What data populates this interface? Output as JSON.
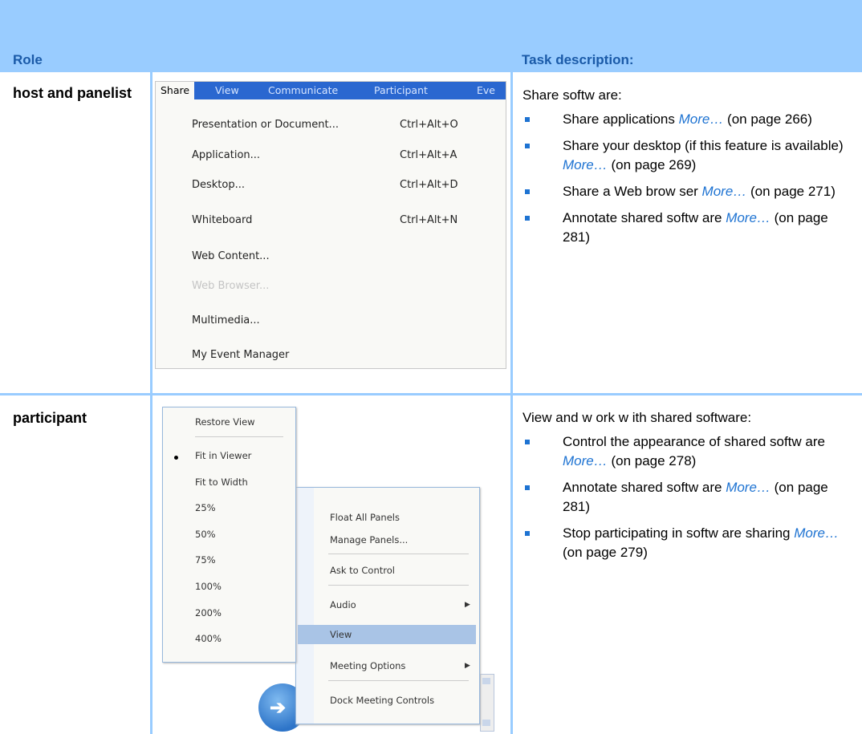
{
  "header": {
    "role_label": "Role",
    "task_label": "Task description:"
  },
  "rows": [
    {
      "role": "host and panelist",
      "task_title": "Share softw are:",
      "items": [
        {
          "text": "Share applications ",
          "more": "More…",
          "suffix": " (on page 266)"
        },
        {
          "text": "Share your desktop (if this feature is available) ",
          "more": "More…",
          "suffix": " (on page 269)"
        },
        {
          "text": "Share a Web brow ser ",
          "more": "More…",
          "suffix": " (on page 271)"
        },
        {
          "text": "Annotate shared softw are ",
          "more": "More…",
          "suffix": " (on page 281)"
        }
      ]
    },
    {
      "role": "participant",
      "task_title": "View and w ork w ith shared software:",
      "items": [
        {
          "text": "Control the appearance of shared softw are ",
          "more": "More…",
          "suffix": " (on page 278)"
        },
        {
          "text": "Annotate shared softw are ",
          "more": "More…",
          "suffix": " (on page 281)"
        },
        {
          "text": "Stop participating in softw are sharing ",
          "more": "More…",
          "suffix": " (on page 279)"
        }
      ]
    }
  ],
  "share_menu": {
    "menubar": [
      "Share",
      "View",
      "Communicate",
      "Participant",
      "Eve"
    ],
    "items": [
      {
        "label": "Presentation or Document...",
        "shortcut": "Ctrl+Alt+O"
      },
      {
        "label": "Application...",
        "shortcut": "Ctrl+Alt+A"
      },
      {
        "label": "Desktop...",
        "shortcut": "Ctrl+Alt+D"
      },
      {
        "label": "Whiteboard",
        "shortcut": "Ctrl+Alt+N"
      },
      {
        "label": "Web Content...",
        "shortcut": ""
      },
      {
        "label": "Web Browser...",
        "shortcut": ""
      },
      {
        "label": "Multimedia...",
        "shortcut": ""
      },
      {
        "label": "My Event Manager",
        "shortcut": ""
      }
    ]
  },
  "view_menu": {
    "items": [
      "Restore View",
      "Fit in Viewer",
      "Fit to Width",
      "25%",
      "50%",
      "75%",
      "100%",
      "200%",
      "400%"
    ]
  },
  "context_menu": {
    "items": [
      "Float All Panels",
      "Manage Panels...",
      "Ask to Control",
      "Audio",
      "View",
      "Meeting Options",
      "Dock Meeting Controls"
    ]
  }
}
